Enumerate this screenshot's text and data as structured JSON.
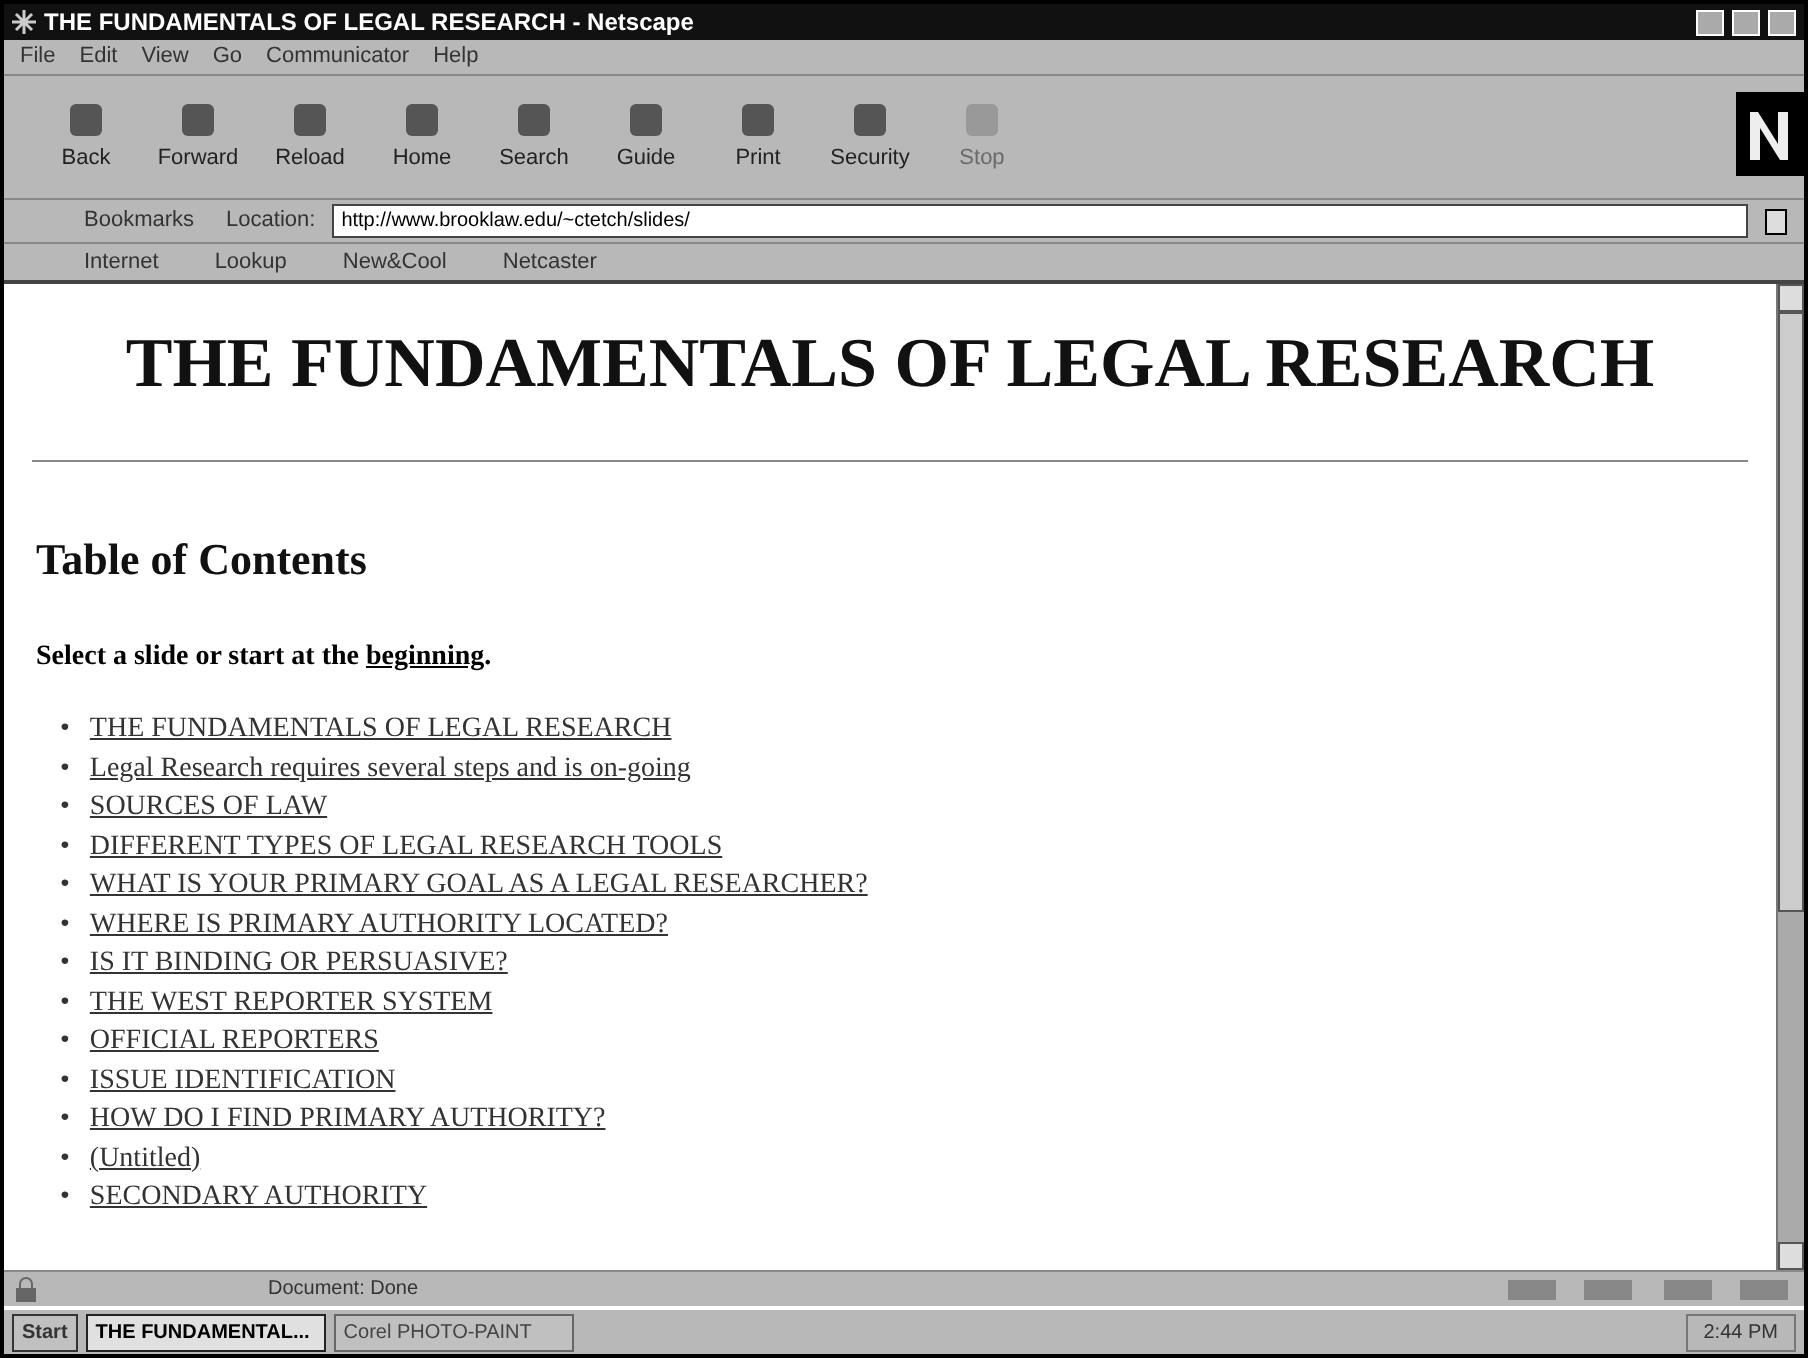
{
  "window": {
    "title": "THE FUNDAMENTALS OF LEGAL RESEARCH - Netscape"
  },
  "menu": [
    "File",
    "Edit",
    "View",
    "Go",
    "Communicator",
    "Help"
  ],
  "toolbar": [
    {
      "label": "Back",
      "disabled": false
    },
    {
      "label": "Forward",
      "disabled": false
    },
    {
      "label": "Reload",
      "disabled": false
    },
    {
      "label": "Home",
      "disabled": false
    },
    {
      "label": "Search",
      "disabled": false
    },
    {
      "label": "Guide",
      "disabled": false
    },
    {
      "label": "Print",
      "disabled": false
    },
    {
      "label": "Security",
      "disabled": false
    },
    {
      "label": "Stop",
      "disabled": true
    }
  ],
  "location_bar": {
    "bookmarks": "Bookmarks",
    "label": "Location:",
    "url": "http://www.brooklaw.edu/~ctetch/slides/"
  },
  "personal_toolbar": [
    "Internet",
    "Lookup",
    "New&Cool",
    "Netcaster"
  ],
  "page": {
    "heading": "THE FUNDAMENTALS OF LEGAL RESEARCH",
    "subheading": "Table of Contents",
    "intro": "Select a slide or start at the",
    "intro_link": "beginning",
    "intro_end": ".",
    "bullet": "•",
    "links": [
      "THE FUNDAMENTALS OF LEGAL RESEARCH",
      "Legal Research requires several steps and is on-going",
      "SOURCES OF LAW",
      "DIFFERENT TYPES OF LEGAL RESEARCH TOOLS",
      "WHAT IS YOUR PRIMARY GOAL AS A LEGAL RESEARCHER?",
      "WHERE IS PRIMARY AUTHORITY LOCATED?",
      "IS IT BINDING OR PERSUASIVE?",
      "THE WEST REPORTER SYSTEM",
      "OFFICIAL REPORTERS",
      "ISSUE IDENTIFICATION",
      "HOW DO I FIND PRIMARY AUTHORITY?",
      "(Untitled)",
      "SECONDARY AUTHORITY"
    ]
  },
  "status_bar": {
    "text": "Document: Done"
  },
  "taskbar": {
    "start": "Start",
    "tasks": [
      {
        "label": "THE FUNDAMENTAL...",
        "selected": true
      },
      {
        "label": "Corel PHOTO-PAINT",
        "selected": false
      }
    ],
    "clock": "2:44 PM"
  }
}
